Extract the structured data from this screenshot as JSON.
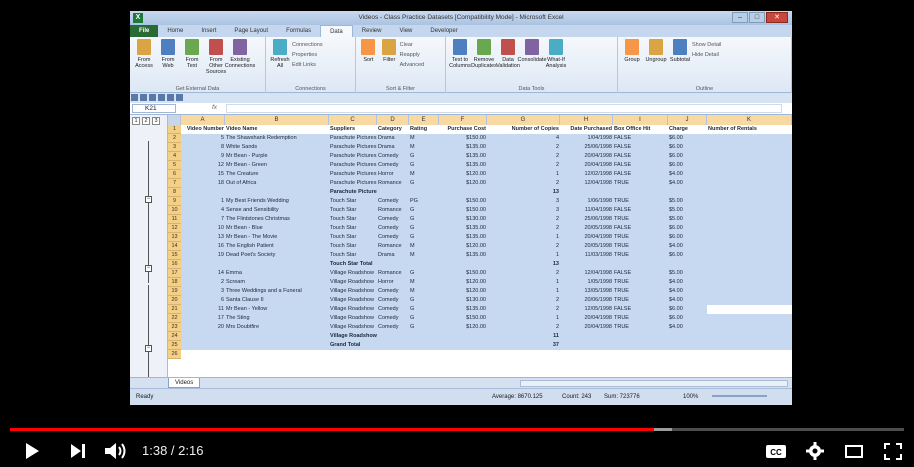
{
  "excel": {
    "title": "Videos - Class Practice Datasets [Compatibility Mode] - Microsoft Excel",
    "tabs": [
      "File",
      "Home",
      "Insert",
      "Page Layout",
      "Formulas",
      "Data",
      "Review",
      "View",
      "Developer"
    ],
    "active_tab": "Data",
    "ribbon_groups": [
      {
        "label": "Get External Data",
        "buttons": [
          "From Access",
          "From Web",
          "From Text",
          "From Other Sources",
          "Existing Connections"
        ]
      },
      {
        "label": "Connections",
        "buttons": [
          "Refresh All"
        ],
        "small": [
          "Connections",
          "Properties",
          "Edit Links"
        ]
      },
      {
        "label": "Sort & Filter",
        "buttons": [
          "Sort",
          "Filter"
        ],
        "small": [
          "Clear",
          "Reapply",
          "Advanced"
        ]
      },
      {
        "label": "Data Tools",
        "buttons": [
          "Text to Columns",
          "Remove Duplicates",
          "Data Validation",
          "Consolidate",
          "What-If Analysis"
        ]
      },
      {
        "label": "Outline",
        "buttons": [
          "Group",
          "Ungroup",
          "Subtotal"
        ],
        "small": [
          "Show Detail",
          "Hide Detail"
        ]
      }
    ],
    "name_box": "K21",
    "fx": "fx",
    "columns": [
      "A",
      "B",
      "C",
      "D",
      "E",
      "F",
      "G",
      "H",
      "I",
      "J",
      "K"
    ],
    "headers": [
      "Video Number",
      "Video Name",
      "Suppliers",
      "Category",
      "Rating",
      "Purchase Cost",
      "Number of Copies",
      "Date Purchased",
      "Box Office Hit",
      "Charge",
      "Number of Rentals"
    ],
    "rows": [
      {
        "n": "2",
        "c": [
          "5",
          "The Shawshank Redemption",
          "Parachute Pictures",
          "Drama",
          "M",
          "$150.00",
          "4",
          "1/04/1998",
          "FALSE",
          "$6.00",
          ""
        ]
      },
      {
        "n": "3",
        "c": [
          "8",
          "White Sands",
          "Parachute Pictures",
          "Drama",
          "M",
          "$135.00",
          "2",
          "25/06/1998",
          "FALSE",
          "$6.00",
          ""
        ]
      },
      {
        "n": "4",
        "c": [
          "9",
          "Mr Bean - Purple",
          "Parachute Pictures",
          "Comedy",
          "G",
          "$135.00",
          "2",
          "20/04/1998",
          "FALSE",
          "$6.00",
          ""
        ]
      },
      {
        "n": "5",
        "c": [
          "12",
          "Mr Bean - Green",
          "Parachute Pictures",
          "Comedy",
          "G",
          "$135.00",
          "2",
          "20/04/1998",
          "FALSE",
          "$6.00",
          ""
        ]
      },
      {
        "n": "6",
        "c": [
          "15",
          "The Creature",
          "Parachute Pictures",
          "Horror",
          "M",
          "$120.00",
          "1",
          "12/02/1998",
          "FALSE",
          "$4.00",
          ""
        ]
      },
      {
        "n": "7",
        "c": [
          "18",
          "Out of Africa",
          "Parachute Pictures",
          "Romance",
          "G",
          "$120.00",
          "2",
          "12/04/1998",
          "TRUE",
          "$4.00",
          ""
        ]
      },
      {
        "n": "8",
        "c": [
          "",
          "",
          "Parachute Pictures Total",
          "",
          "",
          "",
          "13",
          "",
          "",
          "",
          ""
        ],
        "bold": true
      },
      {
        "n": "9",
        "c": [
          "1",
          "My Best Friends Wedding",
          "Touch Star",
          "Comedy",
          "PG",
          "$150.00",
          "3",
          "1/06/1998",
          "TRUE",
          "$5.00",
          ""
        ]
      },
      {
        "n": "10",
        "c": [
          "4",
          "Sense and Sensibility",
          "Touch Star",
          "Romance",
          "G",
          "$150.00",
          "3",
          "11/04/1998",
          "FALSE",
          "$5.00",
          ""
        ]
      },
      {
        "n": "11",
        "c": [
          "7",
          "The Flintstones Christmas",
          "Touch Star",
          "Comedy",
          "G",
          "$130.00",
          "2",
          "25/06/1998",
          "TRUE",
          "$5.00",
          ""
        ]
      },
      {
        "n": "12",
        "c": [
          "10",
          "Mr Bean - Blue",
          "Touch Star",
          "Comedy",
          "G",
          "$135.00",
          "2",
          "20/05/1998",
          "FALSE",
          "$6.00",
          ""
        ]
      },
      {
        "n": "13",
        "c": [
          "13",
          "Mr Bean - The Movie",
          "Touch Star",
          "Comedy",
          "G",
          "$135.00",
          "1",
          "20/04/1998",
          "TRUE",
          "$6.00",
          ""
        ]
      },
      {
        "n": "14",
        "c": [
          "16",
          "The English Patient",
          "Touch Star",
          "Romance",
          "M",
          "$120.00",
          "2",
          "20/05/1998",
          "TRUE",
          "$4.00",
          ""
        ]
      },
      {
        "n": "15",
        "c": [
          "19",
          "Dead Poet's Society",
          "Touch Star",
          "Drama",
          "M",
          "$135.00",
          "1",
          "11/03/1998",
          "TRUE",
          "$6.00",
          ""
        ]
      },
      {
        "n": "16",
        "c": [
          "",
          "",
          "Touch Star Total",
          "",
          "",
          "",
          "13",
          "",
          "",
          "",
          ""
        ],
        "bold": true
      },
      {
        "n": "17",
        "c": [
          "14",
          "Emma",
          "Village Roadshow",
          "Romance",
          "G",
          "$150.00",
          "2",
          "12/04/1998",
          "FALSE",
          "$5.00",
          ""
        ]
      },
      {
        "n": "18",
        "c": [
          "2",
          "Scream",
          "Village Roadshow",
          "Horror",
          "M",
          "$120.00",
          "1",
          "1/05/1998",
          "TRUE",
          "$4.00",
          ""
        ]
      },
      {
        "n": "19",
        "c": [
          "3",
          "Three Weddings and a Funeral",
          "Village Roadshow",
          "Comedy",
          "M",
          "$120.00",
          "1",
          "13/05/1998",
          "TRUE",
          "$4.00",
          ""
        ]
      },
      {
        "n": "20",
        "c": [
          "6",
          "Santa Clause II",
          "Village Roadshow",
          "Comedy",
          "G",
          "$130.00",
          "2",
          "20/06/1998",
          "TRUE",
          "$4.00",
          ""
        ]
      },
      {
        "n": "21",
        "c": [
          "11",
          "Mr Bean - Yellow",
          "Village Roadshow",
          "Comedy",
          "G",
          "$135.00",
          "2",
          "12/05/1998",
          "FALSE",
          "$6.00",
          ""
        ]
      },
      {
        "n": "22",
        "c": [
          "17",
          "The Sting",
          "Village Roadshow",
          "Comedy",
          "G",
          "$150.00",
          "1",
          "20/04/1998",
          "TRUE",
          "$6.00",
          ""
        ]
      },
      {
        "n": "23",
        "c": [
          "20",
          "Mrs Doubtfire",
          "Village Roadshow",
          "Comedy",
          "G",
          "$120.00",
          "2",
          "20/04/1998",
          "TRUE",
          "$4.00",
          ""
        ]
      },
      {
        "n": "24",
        "c": [
          "",
          "",
          "Village Roadshow Total",
          "",
          "",
          "",
          "11",
          "",
          "",
          "",
          ""
        ],
        "bold": true
      },
      {
        "n": "25",
        "c": [
          "",
          "",
          "Grand Total",
          "",
          "",
          "",
          "37",
          "",
          "",
          "",
          ""
        ],
        "bold": true
      },
      {
        "n": "26",
        "c": [
          "",
          "",
          "",
          "",
          "",
          "",
          "",
          "",
          "",
          "",
          ""
        ]
      }
    ],
    "sheet_tab": "Videos",
    "status_left": "Ready",
    "status_average": "Average: 8670.125",
    "status_count": "Count: 243",
    "status_sum": "Sum: 723776",
    "zoom": "100%"
  },
  "player": {
    "time": "1:38 / 2:16",
    "played_fraction": 0.72,
    "loaded_fraction": 0.74
  }
}
